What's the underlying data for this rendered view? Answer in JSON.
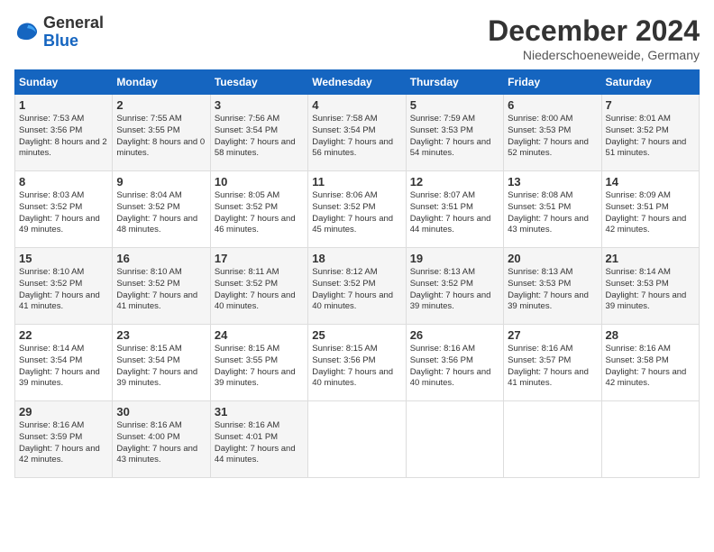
{
  "logo": {
    "general": "General",
    "blue": "Blue"
  },
  "title": "December 2024",
  "location": "Niederschoeneweide, Germany",
  "headers": [
    "Sunday",
    "Monday",
    "Tuesday",
    "Wednesday",
    "Thursday",
    "Friday",
    "Saturday"
  ],
  "weeks": [
    [
      {
        "day": "1",
        "sunrise": "Sunrise: 7:53 AM",
        "sunset": "Sunset: 3:56 PM",
        "daylight": "Daylight: 8 hours and 2 minutes."
      },
      {
        "day": "2",
        "sunrise": "Sunrise: 7:55 AM",
        "sunset": "Sunset: 3:55 PM",
        "daylight": "Daylight: 8 hours and 0 minutes."
      },
      {
        "day": "3",
        "sunrise": "Sunrise: 7:56 AM",
        "sunset": "Sunset: 3:54 PM",
        "daylight": "Daylight: 7 hours and 58 minutes."
      },
      {
        "day": "4",
        "sunrise": "Sunrise: 7:58 AM",
        "sunset": "Sunset: 3:54 PM",
        "daylight": "Daylight: 7 hours and 56 minutes."
      },
      {
        "day": "5",
        "sunrise": "Sunrise: 7:59 AM",
        "sunset": "Sunset: 3:53 PM",
        "daylight": "Daylight: 7 hours and 54 minutes."
      },
      {
        "day": "6",
        "sunrise": "Sunrise: 8:00 AM",
        "sunset": "Sunset: 3:53 PM",
        "daylight": "Daylight: 7 hours and 52 minutes."
      },
      {
        "day": "7",
        "sunrise": "Sunrise: 8:01 AM",
        "sunset": "Sunset: 3:52 PM",
        "daylight": "Daylight: 7 hours and 51 minutes."
      }
    ],
    [
      {
        "day": "8",
        "sunrise": "Sunrise: 8:03 AM",
        "sunset": "Sunset: 3:52 PM",
        "daylight": "Daylight: 7 hours and 49 minutes."
      },
      {
        "day": "9",
        "sunrise": "Sunrise: 8:04 AM",
        "sunset": "Sunset: 3:52 PM",
        "daylight": "Daylight: 7 hours and 48 minutes."
      },
      {
        "day": "10",
        "sunrise": "Sunrise: 8:05 AM",
        "sunset": "Sunset: 3:52 PM",
        "daylight": "Daylight: 7 hours and 46 minutes."
      },
      {
        "day": "11",
        "sunrise": "Sunrise: 8:06 AM",
        "sunset": "Sunset: 3:52 PM",
        "daylight": "Daylight: 7 hours and 45 minutes."
      },
      {
        "day": "12",
        "sunrise": "Sunrise: 8:07 AM",
        "sunset": "Sunset: 3:51 PM",
        "daylight": "Daylight: 7 hours and 44 minutes."
      },
      {
        "day": "13",
        "sunrise": "Sunrise: 8:08 AM",
        "sunset": "Sunset: 3:51 PM",
        "daylight": "Daylight: 7 hours and 43 minutes."
      },
      {
        "day": "14",
        "sunrise": "Sunrise: 8:09 AM",
        "sunset": "Sunset: 3:51 PM",
        "daylight": "Daylight: 7 hours and 42 minutes."
      }
    ],
    [
      {
        "day": "15",
        "sunrise": "Sunrise: 8:10 AM",
        "sunset": "Sunset: 3:52 PM",
        "daylight": "Daylight: 7 hours and 41 minutes."
      },
      {
        "day": "16",
        "sunrise": "Sunrise: 8:10 AM",
        "sunset": "Sunset: 3:52 PM",
        "daylight": "Daylight: 7 hours and 41 minutes."
      },
      {
        "day": "17",
        "sunrise": "Sunrise: 8:11 AM",
        "sunset": "Sunset: 3:52 PM",
        "daylight": "Daylight: 7 hours and 40 minutes."
      },
      {
        "day": "18",
        "sunrise": "Sunrise: 8:12 AM",
        "sunset": "Sunset: 3:52 PM",
        "daylight": "Daylight: 7 hours and 40 minutes."
      },
      {
        "day": "19",
        "sunrise": "Sunrise: 8:13 AM",
        "sunset": "Sunset: 3:52 PM",
        "daylight": "Daylight: 7 hours and 39 minutes."
      },
      {
        "day": "20",
        "sunrise": "Sunrise: 8:13 AM",
        "sunset": "Sunset: 3:53 PM",
        "daylight": "Daylight: 7 hours and 39 minutes."
      },
      {
        "day": "21",
        "sunrise": "Sunrise: 8:14 AM",
        "sunset": "Sunset: 3:53 PM",
        "daylight": "Daylight: 7 hours and 39 minutes."
      }
    ],
    [
      {
        "day": "22",
        "sunrise": "Sunrise: 8:14 AM",
        "sunset": "Sunset: 3:54 PM",
        "daylight": "Daylight: 7 hours and 39 minutes."
      },
      {
        "day": "23",
        "sunrise": "Sunrise: 8:15 AM",
        "sunset": "Sunset: 3:54 PM",
        "daylight": "Daylight: 7 hours and 39 minutes."
      },
      {
        "day": "24",
        "sunrise": "Sunrise: 8:15 AM",
        "sunset": "Sunset: 3:55 PM",
        "daylight": "Daylight: 7 hours and 39 minutes."
      },
      {
        "day": "25",
        "sunrise": "Sunrise: 8:15 AM",
        "sunset": "Sunset: 3:56 PM",
        "daylight": "Daylight: 7 hours and 40 minutes."
      },
      {
        "day": "26",
        "sunrise": "Sunrise: 8:16 AM",
        "sunset": "Sunset: 3:56 PM",
        "daylight": "Daylight: 7 hours and 40 minutes."
      },
      {
        "day": "27",
        "sunrise": "Sunrise: 8:16 AM",
        "sunset": "Sunset: 3:57 PM",
        "daylight": "Daylight: 7 hours and 41 minutes."
      },
      {
        "day": "28",
        "sunrise": "Sunrise: 8:16 AM",
        "sunset": "Sunset: 3:58 PM",
        "daylight": "Daylight: 7 hours and 42 minutes."
      }
    ],
    [
      {
        "day": "29",
        "sunrise": "Sunrise: 8:16 AM",
        "sunset": "Sunset: 3:59 PM",
        "daylight": "Daylight: 7 hours and 42 minutes."
      },
      {
        "day": "30",
        "sunrise": "Sunrise: 8:16 AM",
        "sunset": "Sunset: 4:00 PM",
        "daylight": "Daylight: 7 hours and 43 minutes."
      },
      {
        "day": "31",
        "sunrise": "Sunrise: 8:16 AM",
        "sunset": "Sunset: 4:01 PM",
        "daylight": "Daylight: 7 hours and 44 minutes."
      },
      null,
      null,
      null,
      null
    ]
  ]
}
